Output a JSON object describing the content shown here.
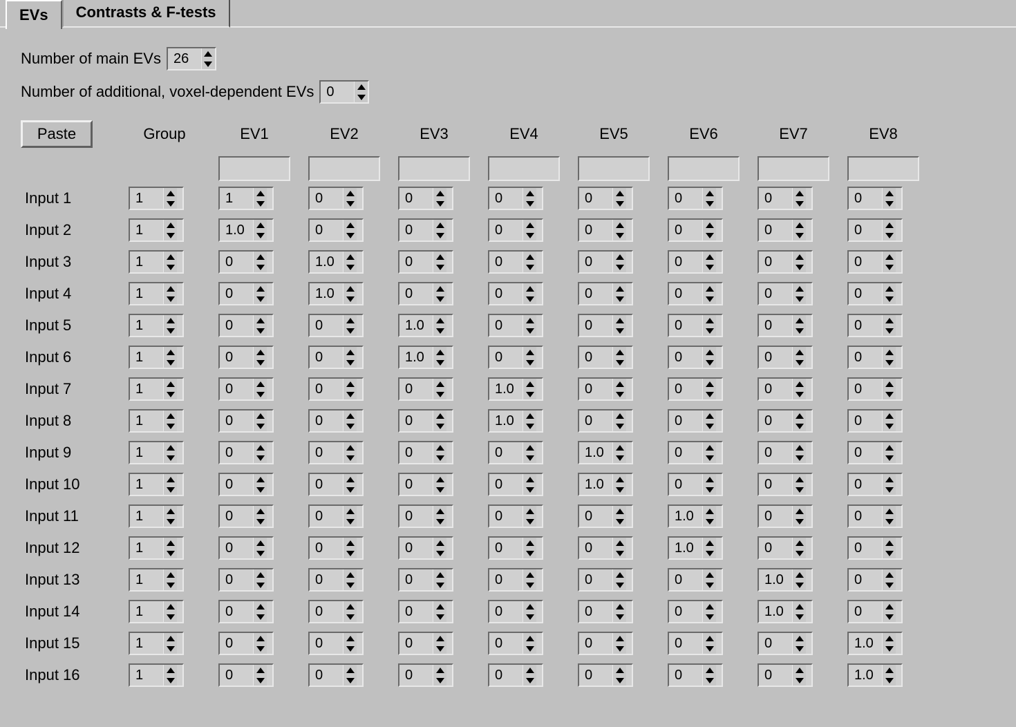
{
  "tabs": {
    "evs": "EVs",
    "contrasts": "Contrasts & F-tests"
  },
  "main_evs_label": "Number of main EVs",
  "main_evs_value": "26",
  "addl_evs_label": "Number of additional, voxel-dependent EVs",
  "addl_evs_value": "0",
  "paste_label": "Paste",
  "group_label": "Group",
  "ev_headers": [
    "EV1",
    "EV2",
    "EV3",
    "EV4",
    "EV5",
    "EV6",
    "EV7",
    "EV8"
  ],
  "inputs": [
    {
      "name": "Input 1",
      "group": "1",
      "evs": [
        "1",
        "0",
        "0",
        "0",
        "0",
        "0",
        "0",
        "0"
      ]
    },
    {
      "name": "Input 2",
      "group": "1",
      "evs": [
        "1.0",
        "0",
        "0",
        "0",
        "0",
        "0",
        "0",
        "0"
      ]
    },
    {
      "name": "Input 3",
      "group": "1",
      "evs": [
        "0",
        "1.0",
        "0",
        "0",
        "0",
        "0",
        "0",
        "0"
      ]
    },
    {
      "name": "Input 4",
      "group": "1",
      "evs": [
        "0",
        "1.0",
        "0",
        "0",
        "0",
        "0",
        "0",
        "0"
      ]
    },
    {
      "name": "Input 5",
      "group": "1",
      "evs": [
        "0",
        "0",
        "1.0",
        "0",
        "0",
        "0",
        "0",
        "0"
      ]
    },
    {
      "name": "Input 6",
      "group": "1",
      "evs": [
        "0",
        "0",
        "1.0",
        "0",
        "0",
        "0",
        "0",
        "0"
      ]
    },
    {
      "name": "Input 7",
      "group": "1",
      "evs": [
        "0",
        "0",
        "0",
        "1.0",
        "0",
        "0",
        "0",
        "0"
      ]
    },
    {
      "name": "Input 8",
      "group": "1",
      "evs": [
        "0",
        "0",
        "0",
        "1.0",
        "0",
        "0",
        "0",
        "0"
      ]
    },
    {
      "name": "Input 9",
      "group": "1",
      "evs": [
        "0",
        "0",
        "0",
        "0",
        "1.0",
        "0",
        "0",
        "0"
      ]
    },
    {
      "name": "Input 10",
      "group": "1",
      "evs": [
        "0",
        "0",
        "0",
        "0",
        "1.0",
        "0",
        "0",
        "0"
      ]
    },
    {
      "name": "Input 11",
      "group": "1",
      "evs": [
        "0",
        "0",
        "0",
        "0",
        "0",
        "1.0",
        "0",
        "0"
      ]
    },
    {
      "name": "Input 12",
      "group": "1",
      "evs": [
        "0",
        "0",
        "0",
        "0",
        "0",
        "1.0",
        "0",
        "0"
      ]
    },
    {
      "name": "Input 13",
      "group": "1",
      "evs": [
        "0",
        "0",
        "0",
        "0",
        "0",
        "0",
        "1.0",
        "0"
      ]
    },
    {
      "name": "Input 14",
      "group": "1",
      "evs": [
        "0",
        "0",
        "0",
        "0",
        "0",
        "0",
        "1.0",
        "0"
      ]
    },
    {
      "name": "Input 15",
      "group": "1",
      "evs": [
        "0",
        "0",
        "0",
        "0",
        "0",
        "0",
        "0",
        "1.0"
      ]
    },
    {
      "name": "Input 16",
      "group": "1",
      "evs": [
        "0",
        "0",
        "0",
        "0",
        "0",
        "0",
        "0",
        "1.0"
      ]
    }
  ]
}
